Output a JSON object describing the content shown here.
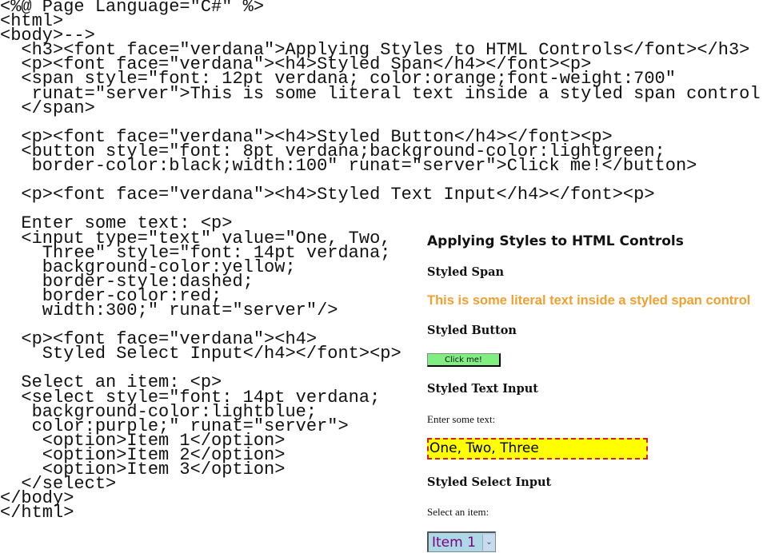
{
  "code_lines": [
    "<%@ Page Language=\"C#\" %>",
    "<html>",
    "<body>-->",
    "  <h3><font face=\"verdana\">Applying Styles to HTML Controls</font></h3>",
    "  <p><font face=\"verdana\"><h4>Styled Span</h4></font><p>",
    "  <span style=\"font: 12pt verdana; color:orange;font-weight:700\"",
    "   runat=\"server\">This is some literal text inside a styled span control",
    "  </span>",
    "",
    "  <p><font face=\"verdana\"><h4>Styled Button</h4></font><p>",
    "  <button style=\"font: 8pt verdana;background-color:lightgreen;",
    "   border-color:black;width:100\" runat=\"server\">Click me!</button>",
    "",
    "  <p><font face=\"verdana\"><h4>Styled Text Input</h4></font><p>",
    "",
    "  Enter some text: <p>",
    "  <input type=\"text\" value=\"One, Two,",
    "    Three\" style=\"font: 14pt verdana;",
    "    background-color:yellow;",
    "    border-style:dashed;",
    "    border-color:red;",
    "    width:300;\" runat=\"server\"/>",
    "",
    "  <p><font face=\"verdana\"><h4>",
    "    Styled Select Input</h4></font><p>",
    "",
    "  Select an item: <p>",
    "  <select style=\"font: 14pt verdana;",
    "   background-color:lightblue;",
    "   color:purple;\" runat=\"server\">",
    "    <option>Item 1</option>",
    "    <option>Item 2</option>",
    "    <option>Item 3</option>",
    "  </select>",
    "</body>",
    "</html>"
  ],
  "preview": {
    "title": "Applying Styles to HTML Controls",
    "span_heading": "Styled Span",
    "span_text": "This is some literal text inside a styled span control",
    "button_heading": "Styled Button",
    "button_label": "Click me!",
    "text_input_heading": "Styled Text Input",
    "text_input_label": "Enter some text:",
    "text_input_value": "One, Two, Three",
    "select_heading": "Styled Select Input",
    "select_label": "Select an item:",
    "select_value": "Item 1",
    "select_arrow_icon": "chevron-down-icon",
    "colors": {
      "span": "#f0a030",
      "button_bg": "#80ee80",
      "input_bg": "#ffff00",
      "input_border": "#d02020",
      "select_bg": "#add8e6",
      "select_text": "#800080"
    }
  }
}
